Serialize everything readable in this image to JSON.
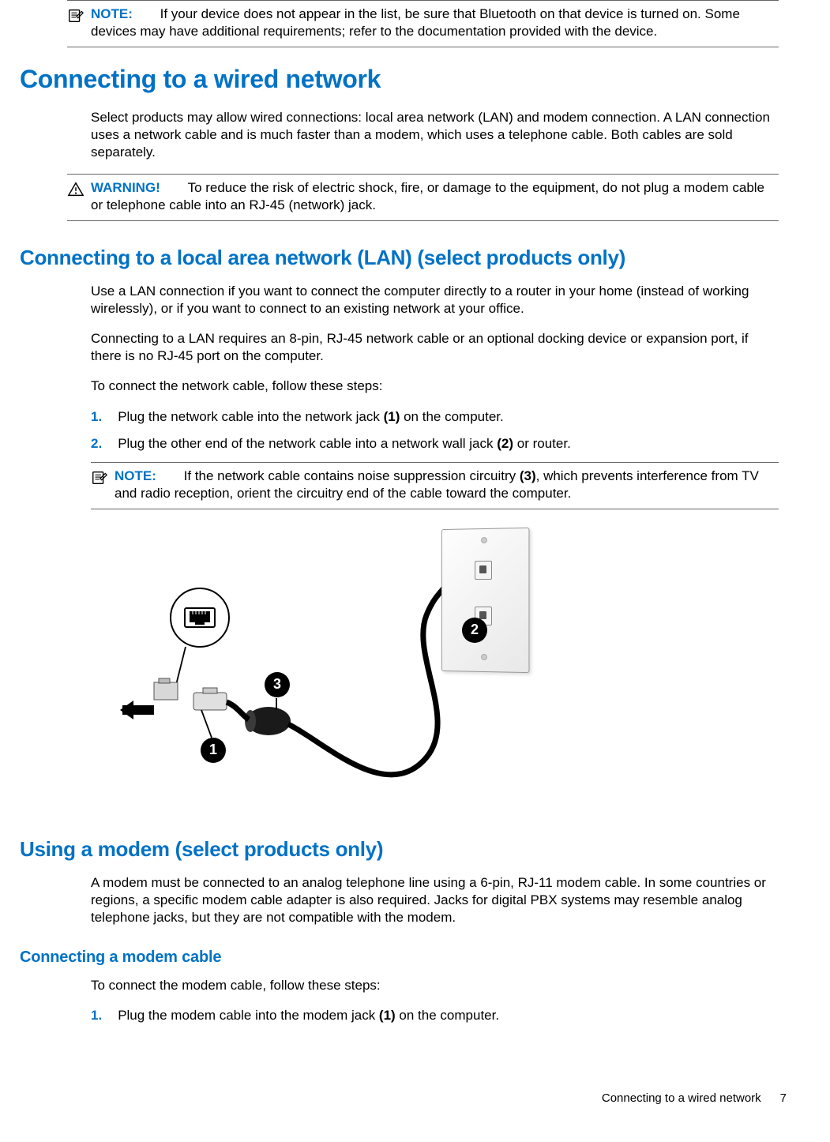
{
  "note_top": {
    "label": "NOTE:",
    "text": "If your device does not appear in the list, be sure that Bluetooth on that device is turned on. Some devices may have additional requirements; refer to the documentation provided with the device."
  },
  "h1": "Connecting to a wired network",
  "intro": "Select products may allow wired connections: local area network (LAN) and modem connection. A LAN connection uses a network cable and is much faster than a modem, which uses a telephone cable. Both cables are sold separately.",
  "warning": {
    "label": "WARNING!",
    "text": "To reduce the risk of electric shock, fire, or damage to the equipment, do not plug a modem cable or telephone cable into an RJ-45 (network) jack."
  },
  "h2_lan": "Connecting to a local area network (LAN) (select products only)",
  "lan_p1": "Use a LAN connection if you want to connect the computer directly to a router in your home (instead of working wirelessly), or if you want to connect to an existing network at your office.",
  "lan_p2": "Connecting to a LAN requires an 8-pin, RJ-45 network cable or an optional docking device or expansion port, if there is no RJ-45 port on the computer.",
  "lan_p3": "To connect the network cable, follow these steps:",
  "steps": [
    {
      "num": "1.",
      "pre": "Plug the network cable into the network jack ",
      "bold": "(1)",
      "post": " on the computer."
    },
    {
      "num": "2.",
      "pre": "Plug the other end of the network cable into a network wall jack ",
      "bold": "(2)",
      "post": " or router."
    }
  ],
  "note_nested": {
    "label": "NOTE:",
    "pre": "If the network cable contains noise suppression circuitry ",
    "bold": "(3)",
    "post": ", which prevents interference from TV and radio reception, orient the circuitry end of the cable toward the computer."
  },
  "markers": {
    "m1": "1",
    "m2": "2",
    "m3": "3"
  },
  "h2_modem": "Using a modem (select products only)",
  "modem_p1": "A modem must be connected to an analog telephone line using a 6-pin, RJ-11 modem cable. In some countries or regions, a specific modem cable adapter is also required. Jacks for digital PBX systems may resemble analog telephone jacks, but they are not compatible with the modem.",
  "h3_modem_cable": "Connecting a modem cable",
  "modem_p2": "To connect the modem cable, follow these steps:",
  "modem_steps": [
    {
      "num": "1.",
      "pre": "Plug the modem cable into the modem jack ",
      "bold": "(1)",
      "post": " on the computer."
    }
  ],
  "footer": {
    "title": "Connecting to a wired network",
    "page": "7"
  }
}
